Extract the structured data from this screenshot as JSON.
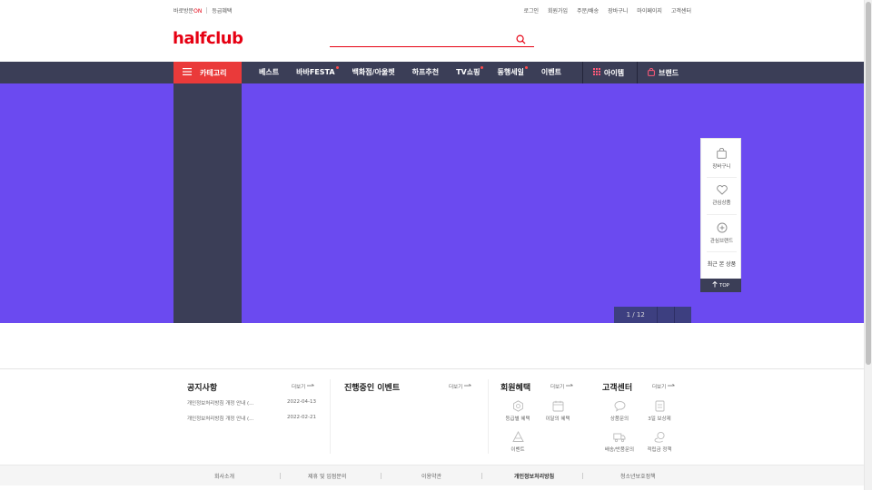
{
  "util": {
    "left": [
      "바로방문",
      "ON",
      "등급혜택"
    ],
    "right": [
      "로그인",
      "회원가입",
      "주문/배송",
      "장바구니",
      "마이페이지",
      "고객센터"
    ]
  },
  "logo": "halfclub",
  "search": {
    "value": "",
    "placeholder": ""
  },
  "gnb": {
    "category": "카테고리",
    "items": [
      "베스트",
      "바바FESTA",
      "백화점/아울렛",
      "하프추천",
      "TV쇼핑",
      "동행세일",
      "이벤트"
    ],
    "item_dots": [
      false,
      true,
      false,
      false,
      true,
      true,
      false
    ],
    "item_label": "아이템",
    "brand_label": "브랜드"
  },
  "banner": {
    "pager": "1 / 12",
    "color": "#6b4af0"
  },
  "quick": {
    "cart": "장바구니",
    "wish": "관심상품",
    "brand": "관심브랜드",
    "recent": "최근 본 상품",
    "top": "TOP"
  },
  "notice": {
    "title": "공지사항",
    "more": "더보기",
    "items": [
      {
        "text": "개인정보처리방침 개정 안내 (...",
        "date": "2022-04-13"
      },
      {
        "text": "개인정보처리방침 개정 안내 (...",
        "date": "2022-02-21"
      }
    ]
  },
  "events": {
    "title": "진행중인 이벤트",
    "more": "더보기"
  },
  "benefits": {
    "title": "회원혜택",
    "more": "더보기",
    "items": [
      "등급별 혜택",
      "이달의 혜택",
      "이벤트"
    ]
  },
  "cs": {
    "title": "고객센터",
    "more": "더보기",
    "items": [
      "상품문의",
      "3일 보상제",
      "배송/반품문의",
      "적립금 정책"
    ]
  },
  "footer": [
    "회사소개",
    "제휴 및 입점문의",
    "이용약관",
    "개인정보처리방침",
    "청소년보호정책"
  ],
  "colors": {
    "accent": "#e60012",
    "nav": "#3b3e57",
    "banner": "#6b4af0"
  }
}
